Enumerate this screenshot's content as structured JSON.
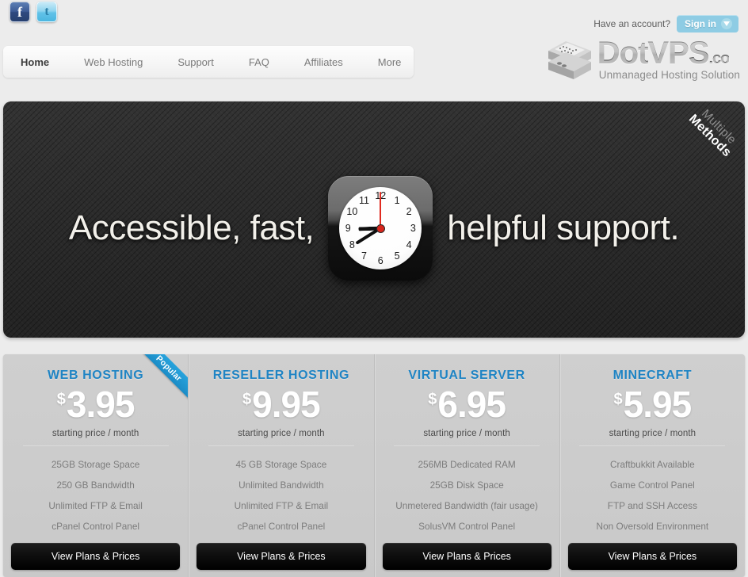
{
  "social": {
    "facebook": {
      "name": "Facebook",
      "glyph": "f"
    },
    "twitter": {
      "name": "Twitter",
      "glyph": "t"
    }
  },
  "account": {
    "prompt": "Have an account?",
    "signin_label": "Sign in"
  },
  "nav": {
    "items": [
      {
        "label": "Home",
        "active": true
      },
      {
        "label": "Web Hosting",
        "active": false
      },
      {
        "label": "Support",
        "active": false
      },
      {
        "label": "FAQ",
        "active": false
      },
      {
        "label": "Affiliates",
        "active": false
      },
      {
        "label": "More",
        "active": false
      }
    ]
  },
  "logo": {
    "main": "DotVPS",
    "tld": ".co",
    "tagline": "Unmanaged Hosting Solution"
  },
  "hero": {
    "text_left": "Accessible, fast,",
    "text_right": "helpful support.",
    "ribbon_line1": "Multiple",
    "ribbon_line2": "Methods",
    "clock": {
      "numbers": [
        "1",
        "2",
        "3",
        "4",
        "5",
        "6",
        "7",
        "8",
        "9",
        "10",
        "11",
        "12"
      ],
      "hour": "9",
      "minute": "8",
      "second": "12"
    }
  },
  "pricing": {
    "price_note": "starting price / month",
    "button_label": "View Plans & Prices",
    "badge_label": "Popular",
    "accent_color": "#1f84c4",
    "cards": [
      {
        "title": "WEB HOSTING",
        "currency": "$",
        "price": "3.95",
        "badge": "Popular",
        "features": [
          "25GB Storage Space",
          "250 GB Bandwidth",
          "Unlimited FTP & Email",
          "cPanel Control Panel"
        ]
      },
      {
        "title": "RESELLER HOSTING",
        "currency": "$",
        "price": "9.95",
        "badge": null,
        "features": [
          "45 GB Storage Space",
          "Unlimited Bandwidth",
          "Unlimited FTP & Email",
          "cPanel Control Panel"
        ]
      },
      {
        "title": "VIRTUAL SERVER",
        "currency": "$",
        "price": "6.95",
        "badge": null,
        "features": [
          "256MB Dedicated RAM",
          "25GB Disk Space",
          "Unmetered Bandwidth (fair usage)",
          "SolusVM Control Panel"
        ]
      },
      {
        "title": "MINECRAFT",
        "currency": "$",
        "price": "5.95",
        "badge": null,
        "features": [
          "Craftbukkit Available",
          "Game Control Panel",
          "FTP and SSH Access",
          "Non Oversold Environment"
        ]
      }
    ]
  }
}
